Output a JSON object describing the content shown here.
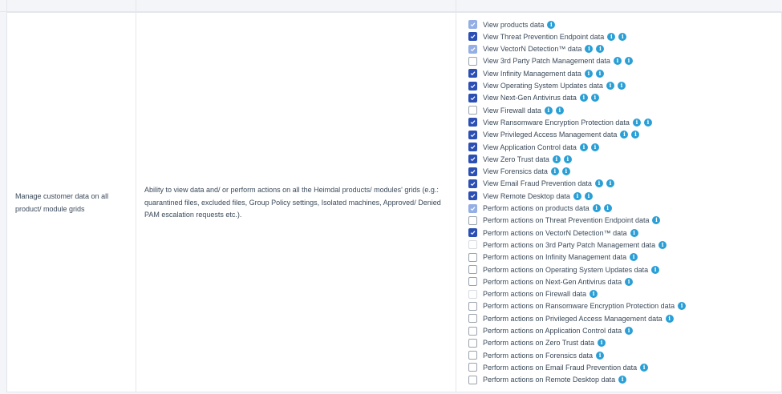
{
  "row": {
    "feature": "Manage customer data on all product/ module grids",
    "description": "Ability to view data and/ or perform actions on all the Heimdal products/ modules' grids (e.g.: quarantined files, excluded files, Group Policy settings, Isolated machines, Approved/ Denied PAM escalation requests etc.).",
    "permissions": [
      {
        "label": "View products data",
        "checked": true,
        "disabled": true,
        "icons": 1
      },
      {
        "label": "View Threat Prevention Endpoint data",
        "checked": true,
        "disabled": false,
        "icons": 2
      },
      {
        "label": "View VectorN Detection™ data",
        "checked": true,
        "disabled": true,
        "icons": 2
      },
      {
        "label": "View 3rd Party Patch Management data",
        "checked": false,
        "disabled": false,
        "icons": 2
      },
      {
        "label": "View Infinity Management data",
        "checked": true,
        "disabled": false,
        "icons": 2
      },
      {
        "label": "View Operating System Updates data",
        "checked": true,
        "disabled": false,
        "icons": 2
      },
      {
        "label": "View Next-Gen Antivirus data",
        "checked": true,
        "disabled": false,
        "icons": 2
      },
      {
        "label": "View Firewall data",
        "checked": false,
        "disabled": false,
        "icons": 2
      },
      {
        "label": "View Ransomware Encryption Protection data",
        "checked": true,
        "disabled": false,
        "icons": 2
      },
      {
        "label": "View Privileged Access Management data",
        "checked": true,
        "disabled": false,
        "icons": 2
      },
      {
        "label": "View Application Control data",
        "checked": true,
        "disabled": false,
        "icons": 2
      },
      {
        "label": "View Zero Trust data",
        "checked": true,
        "disabled": false,
        "icons": 2
      },
      {
        "label": "View Forensics data",
        "checked": true,
        "disabled": false,
        "icons": 2
      },
      {
        "label": "View Email Fraud Prevention data",
        "checked": true,
        "disabled": false,
        "icons": 2
      },
      {
        "label": "View Remote Desktop data",
        "checked": true,
        "disabled": false,
        "icons": 2
      },
      {
        "label": "Perform actions on products data",
        "checked": true,
        "disabled": true,
        "icons": 2
      },
      {
        "label": "Perform actions on Threat Prevention Endpoint data",
        "checked": false,
        "disabled": false,
        "icons": 1
      },
      {
        "label": "Perform actions on VectorN Detection™ data",
        "checked": true,
        "disabled": false,
        "icons": 1
      },
      {
        "label": "Perform actions on 3rd Party Patch Management data",
        "checked": false,
        "disabled": true,
        "icons": 1
      },
      {
        "label": "Perform actions on Infinity Management data",
        "checked": false,
        "disabled": false,
        "icons": 1
      },
      {
        "label": "Perform actions on Operating System Updates data",
        "checked": false,
        "disabled": false,
        "icons": 1
      },
      {
        "label": "Perform actions on Next-Gen Antivirus data",
        "checked": false,
        "disabled": false,
        "icons": 1
      },
      {
        "label": "Perform actions on Firewall data",
        "checked": false,
        "disabled": true,
        "icons": 1
      },
      {
        "label": "Perform actions on Ransomware Encryption Protection data",
        "checked": false,
        "disabled": false,
        "icons": 1
      },
      {
        "label": "Perform actions on Privileged Access Management data",
        "checked": false,
        "disabled": false,
        "icons": 1
      },
      {
        "label": "Perform actions on Application Control data",
        "checked": false,
        "disabled": false,
        "icons": 1
      },
      {
        "label": "Perform actions on Zero Trust data",
        "checked": false,
        "disabled": false,
        "icons": 1
      },
      {
        "label": "Perform actions on Forensics data",
        "checked": false,
        "disabled": false,
        "icons": 1
      },
      {
        "label": "Perform actions on Email Fraud Prevention data",
        "checked": false,
        "disabled": false,
        "icons": 1
      },
      {
        "label": "Perform actions on Remote Desktop data",
        "checked": false,
        "disabled": false,
        "icons": 1
      }
    ]
  },
  "icons": {
    "info": "info-icon",
    "check": "check-icon"
  },
  "colors": {
    "checked": "#2b4fb4",
    "checked_disabled": "#94aee6",
    "info": "#2a9fd6"
  }
}
